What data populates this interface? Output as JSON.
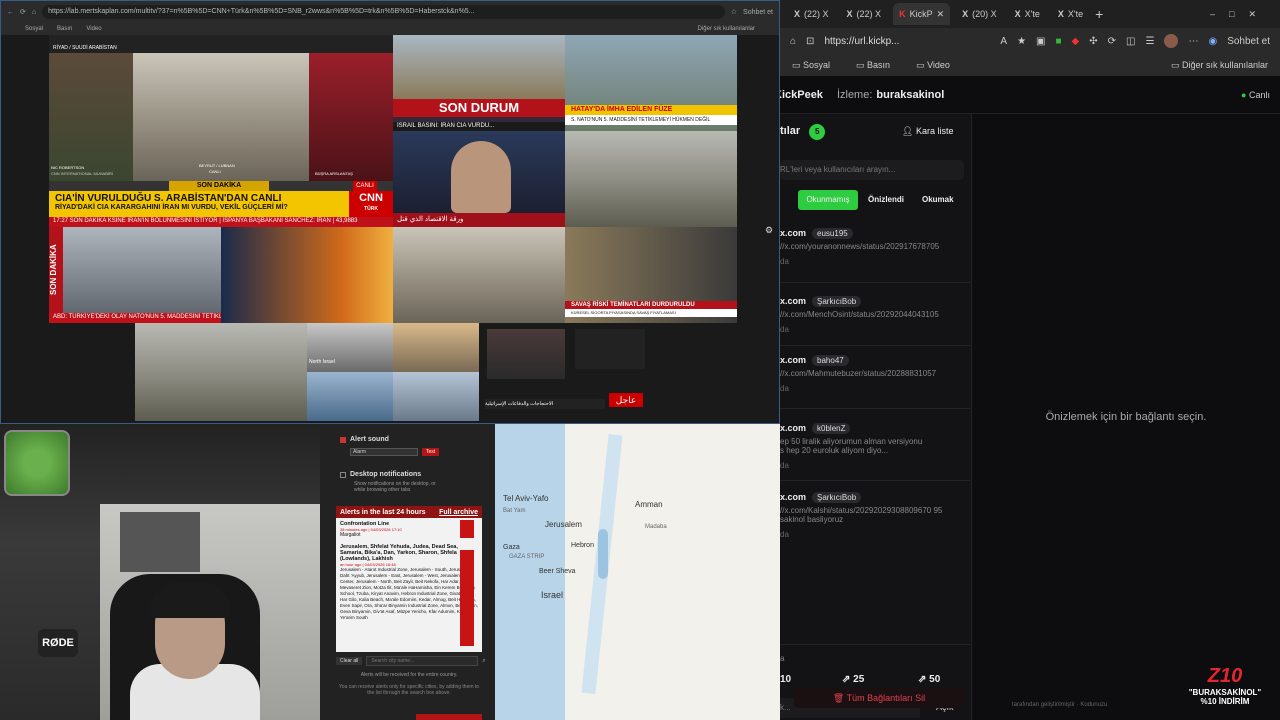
{
  "left_browser": {
    "url": "https://lab.mertskaplan.com/multitv/?37=n%5B%5D=CNN+Türk&n%5B%5D=SNB_r2wws&n%5B%5D=trk&n%5B%5D=Haberstck&n%5...",
    "bookmarks": [
      "Sosyal",
      "Basın",
      "Video"
    ],
    "right_labels": [
      "Sohbet et",
      "Diğer sık kullanılanlar"
    ]
  },
  "tv": {
    "t1_top": "RİYAD / SUUDİ ARABİSTAN",
    "t1_name": "NIC ROBERTSON",
    "t1_role": "CNN INTERNATIONAL MUHABİRİ",
    "t1_place": "BEYRUT / LÜBNAN",
    "t1_place2": "CANLI",
    "t1_anchor": "BÜŞRA ARSLANTAŞ",
    "t1_son": "SON DAKİKA",
    "t1_canli": "CANLI",
    "t1_head1": "CIA'İN VURULDUĞU S. ARABİSTAN'DAN CANLI",
    "t1_head2": "RİYAD'DAKİ CIA KARARGAHINI İRAN MI VURDU, VEKİL GÜÇLERİ Mİ?",
    "t1_tick": "17:27  SON DAKİKA  KSİNE İRAN'IN BÖLÜNMESİNİ İSTİYOR  |  İSPANYA BAŞBAKANI SANCHEZ: İRAN  |  43,9883",
    "cnn": "CNN",
    "turk": "TÜRK",
    "t2_son": "SON DURUM",
    "t2_tick": "İSRAİL BASINI: İRAN CIA VURDU...",
    "t3_title": "HATAY'DA İMHA EDİLEN FÜZE",
    "t3_sub": "S. NATO'NUN 5. MADDESİNİ TETİKLEMEYİ HÜKMEN DEĞİL",
    "t4_tick": "ورقة الاقتصاد الذي قتل",
    "t5_son": "SON DAKİKA",
    "t5_tick": "ABD: TÜRKİYE'DEKİ OLAY NATO'NUN 5. MADDESİNİ TETİKLEMEZ",
    "t8_tick": "SAVAŞ RİSKİ TEMİNATLARI DURDURULDU",
    "t8_sub": "KÜRESEL SİGORTA PİYASASINDA SAVAŞ FİYATLAMASI",
    "north": "North Israel",
    "ajel": "عاجل",
    "t11_tick": "الاحتجاجات والدفاعات الإسرائيلية"
  },
  "alerts": {
    "alert_sound": "Alert sound",
    "sound_option": "Alarm",
    "test": "Test",
    "desk_title": "Desktop notifications",
    "desk_sub1": "Show notifications on the desktop, or",
    "desk_sub2": "while browsing other tabs",
    "last24": "Alerts in the last 24 hours",
    "archive": "Full archive",
    "item1_title": "Confrontation Line",
    "item1_time": "38 minutes ago | 04/03/2026 17:10",
    "item1_zone": "Margaliot",
    "item2_title": "Jerusalem, Shfelat Yehuda, Judea, Dead Sea, Samaria, Bika'a, Dan, Yarkon, Sharon, Shfela (Lowlands), Lakhish",
    "item2_time": "an hour ago | 04/03/2026 16:48",
    "item2_body": "Jerusalem - Atarot Industrial Zone, Jerusalem - South, Jerusalem - Daht 'Ayyub, Jerusalem - East, Jerusalem - West, Jerusalem - Center, Jerusalem - North, Beit Zayit, Beit Nekofa, Har Adar, Mevaseret Zion, Motza Ilit, Ma'ale HaHamisha, Ein Kerem Boarding School, Tzuba, Kiryat Anavim, Hebron Industrial Zone, Givat Ze'ev, Har Gilo, Kalia Beach, Ma'ale Edomim, Kedar, Almog, Beit HaArava, Even Sapir, Ora, Sha'ar Binyamin Industrial Zone, Almon, Beit Horon, Geva Binyamin, Giv'at Asaf, Mitzpe Yericho, Kfar Adumim, Kiryat Ye'arim South",
    "clear_all": "Clear all",
    "search_ph": "Search city name...",
    "foot1": "Alerts will be received for the entire country.",
    "foot2": "You can receive alerts only for specific cities, by adding them to the list through the search box above."
  },
  "map": {
    "labels": [
      "Tel Aviv-Yafo",
      "Amman",
      "Jerusalem",
      "Hebron",
      "Gaza",
      "GAZA STRIP",
      "Beer Sheva",
      "Israel",
      "Bat Yam",
      "Madaba"
    ]
  },
  "right_browser": {
    "tabs": [
      {
        "icon": "X",
        "label": "(22) X"
      },
      {
        "icon": "X",
        "label": "(22) X"
      },
      {
        "icon": "K",
        "label": "KickP"
      },
      {
        "icon": "X",
        "label": "(20) X"
      },
      {
        "icon": "X",
        "label": "X'te"
      },
      {
        "icon": "X",
        "label": "X'te"
      }
    ],
    "url": "https://url.kickp...",
    "sohbet": "Sohbet et",
    "bookmarks": [
      "Sosyal",
      "Basın",
      "Video"
    ],
    "diger": "Diğer sık kullanılanlar"
  },
  "app": {
    "brand": "KickPeek",
    "watch_label": "İzleme:",
    "watch_user": "buraksakinol",
    "status": "Canlı",
    "list_title": "tılar",
    "count": "5",
    "blacklist": "Kara liste",
    "search_ph": "RL'leri veya kullanıcıları arayın...",
    "btn_active": "Okunmamış",
    "btn_preview": "Önizlendi",
    "btn_read": "Okumak",
    "links": [
      {
        "dom": "x.com",
        "user": "eusu195",
        "path": "//x.com/youranonnews/status/202917678705",
        "sub": "da"
      },
      {
        "dom": "x.com",
        "user": "ŞarkıcıBob",
        "path": "//x.com/MenchOsint/status/20292044043105",
        "sub": "da"
      },
      {
        "dom": "x.com",
        "user": "baho47",
        "path": "//x.com/Mahmutebuzer/status/20288831057",
        "sub": "da"
      },
      {
        "dom": "x.com",
        "user": "k0blenZ",
        "path": "ep 50 liralik aliyorumun alman versiyonu\ns hep 20 euroluk aliyom diyo...",
        "sub": "da"
      },
      {
        "dom": "x.com",
        "user": "ŞarkıcıBob",
        "path": "//x.com/Kalshi/status/20292029308809670 95\nsakinol basliyoruz",
        "sub": "da"
      }
    ],
    "preview_msg": "Önizlemek için bir bağlantı seçin.",
    "bottom_sub": "a",
    "page_10": "10",
    "page_25": "25",
    "page_50": "50",
    "open_ph": "k...",
    "open_btn": "Açık",
    "delete_all": "Tüm Bağlantıları Sil",
    "footer": "tarafından geliştirilmiştir · Kodunuzu"
  },
  "overlay": {
    "logo": "Z10",
    "line1": "\"BURAKSAKİNOL\"",
    "line2": "%10 İNDİRİM"
  }
}
